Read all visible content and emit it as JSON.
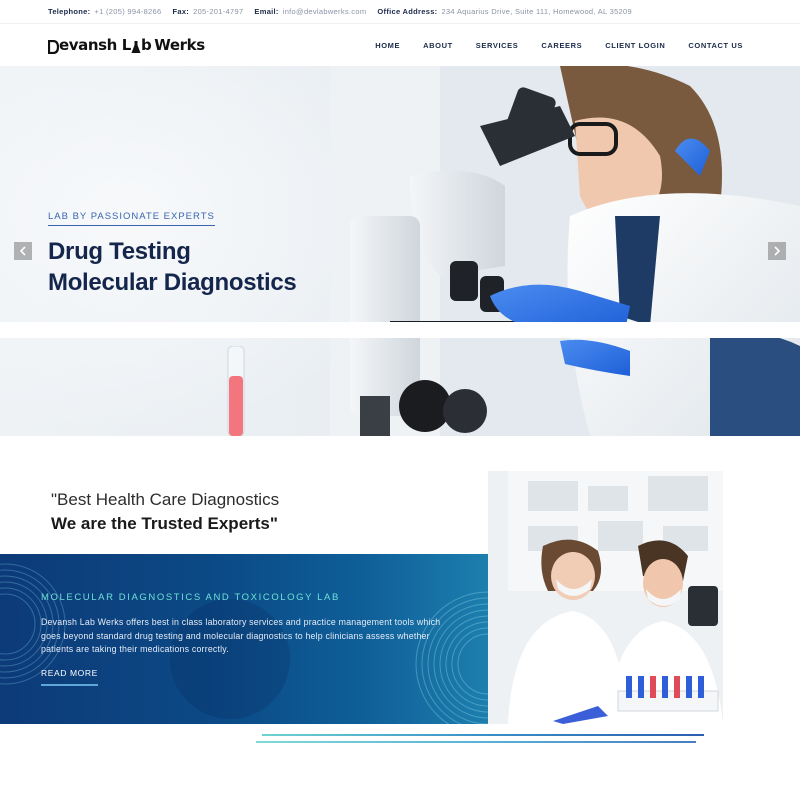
{
  "topbar": {
    "telephone_label": "Telephone:",
    "telephone": "+1 (205) 994-8266",
    "fax_label": "Fax:",
    "fax": "205-201-4797",
    "email_label": "Email:",
    "email": "info@devlabwerks.com",
    "address_label": "Office Address:",
    "address": "234 Aquarius Drive, Suite 111, Homewood, AL 35209"
  },
  "header": {
    "logo_text": "Devansh Lab Werks",
    "logo_left": "evansh L",
    "logo_mid": "b",
    "logo_right": "Werks",
    "nav": [
      {
        "label": "HOME"
      },
      {
        "label": "ABOUT"
      },
      {
        "label": "SERVICES"
      },
      {
        "label": "CAREERS"
      },
      {
        "label": "CLIENT LOGIN"
      },
      {
        "label": "CONTACT US"
      }
    ]
  },
  "hero": {
    "eyebrow": "LAB BY PASSIONATE EXPERTS",
    "title_line1": "Drug Testing",
    "title_line2": "Molecular Diagnostics",
    "prev_icon": "chevron-left-icon",
    "next_icon": "chevron-right-icon"
  },
  "quote": {
    "line1": "\"Best Health Care Diagnostics",
    "line2": "We are the Trusted Experts\""
  },
  "panel": {
    "heading": "MOLECULAR DIAGNOSTICS AND TOXICOLOGY LAB",
    "body": "Devansh Lab Werks offers best in class laboratory services and practice management tools which goes beyond standard drug testing and molecular diagnostics to help clinicians assess whether patients are taking their medications correctly.",
    "read_more": "READ MORE"
  },
  "colors": {
    "navy": "#15264d",
    "accent_blue": "#3a64b0",
    "teal": "#6fe0d6",
    "panel_start": "#0d3a78",
    "panel_end": "#1d7fae"
  }
}
